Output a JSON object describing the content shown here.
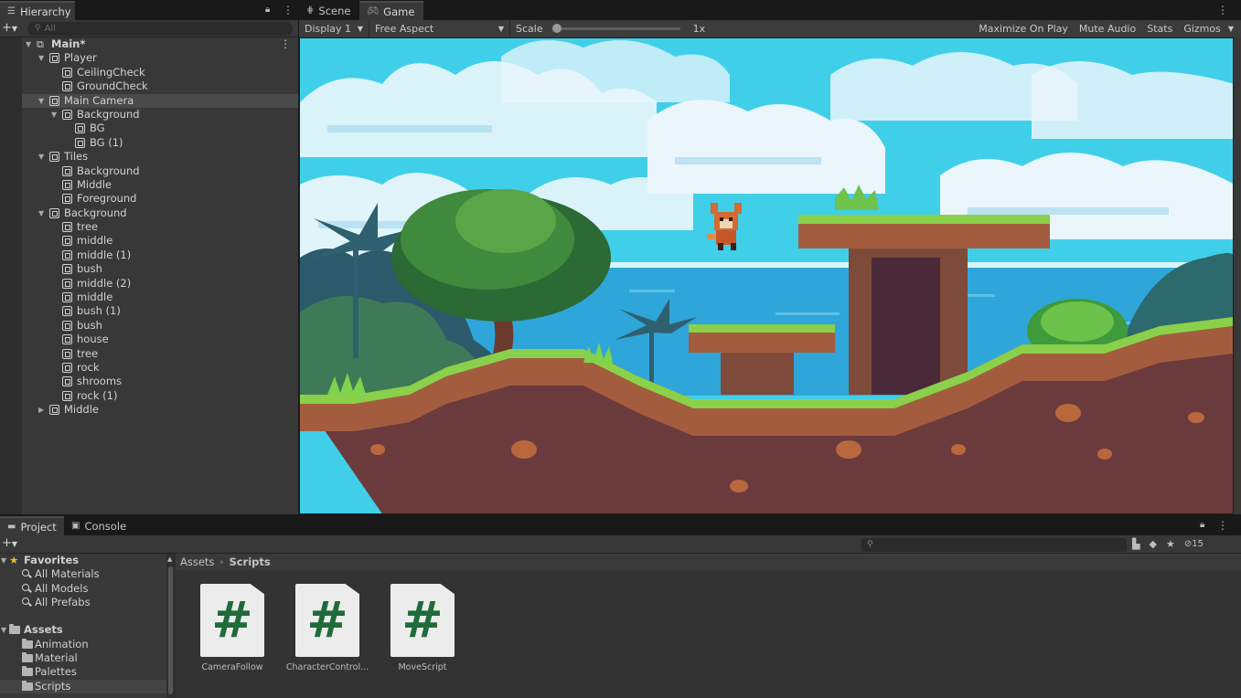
{
  "hierarchy": {
    "tab_label": "Hierarchy",
    "search_placeholder": "All",
    "items": [
      {
        "label": "Main*",
        "depth": 0,
        "arrow": "down",
        "kind": "scene"
      },
      {
        "label": "Player",
        "depth": 1,
        "arrow": "down",
        "kind": "object"
      },
      {
        "label": "CeilingCheck",
        "depth": 2,
        "arrow": "",
        "kind": "object"
      },
      {
        "label": "GroundCheck",
        "depth": 2,
        "arrow": "",
        "kind": "object"
      },
      {
        "label": "Main Camera",
        "depth": 1,
        "arrow": "down",
        "kind": "object",
        "selected": true
      },
      {
        "label": "Background",
        "depth": 2,
        "arrow": "down",
        "kind": "object"
      },
      {
        "label": "BG",
        "depth": 3,
        "arrow": "",
        "kind": "object"
      },
      {
        "label": "BG (1)",
        "depth": 3,
        "arrow": "",
        "kind": "object"
      },
      {
        "label": "Tiles",
        "depth": 1,
        "arrow": "down",
        "kind": "object"
      },
      {
        "label": "Background",
        "depth": 2,
        "arrow": "",
        "kind": "object"
      },
      {
        "label": "Middle",
        "depth": 2,
        "arrow": "",
        "kind": "object"
      },
      {
        "label": "Foreground",
        "depth": 2,
        "arrow": "",
        "kind": "object"
      },
      {
        "label": "Background",
        "depth": 1,
        "arrow": "down",
        "kind": "object"
      },
      {
        "label": "tree",
        "depth": 2,
        "arrow": "",
        "kind": "object"
      },
      {
        "label": "middle",
        "depth": 2,
        "arrow": "",
        "kind": "object"
      },
      {
        "label": "middle (1)",
        "depth": 2,
        "arrow": "",
        "kind": "object"
      },
      {
        "label": "bush",
        "depth": 2,
        "arrow": "",
        "kind": "object"
      },
      {
        "label": "middle (2)",
        "depth": 2,
        "arrow": "",
        "kind": "object"
      },
      {
        "label": "middle",
        "depth": 2,
        "arrow": "",
        "kind": "object"
      },
      {
        "label": "bush (1)",
        "depth": 2,
        "arrow": "",
        "kind": "object"
      },
      {
        "label": "bush",
        "depth": 2,
        "arrow": "",
        "kind": "object"
      },
      {
        "label": "house",
        "depth": 2,
        "arrow": "",
        "kind": "object"
      },
      {
        "label": "tree",
        "depth": 2,
        "arrow": "",
        "kind": "object"
      },
      {
        "label": "rock",
        "depth": 2,
        "arrow": "",
        "kind": "object"
      },
      {
        "label": "shrooms",
        "depth": 2,
        "arrow": "",
        "kind": "object"
      },
      {
        "label": "rock (1)",
        "depth": 2,
        "arrow": "",
        "kind": "object"
      },
      {
        "label": "Middle",
        "depth": 1,
        "arrow": "right",
        "kind": "object"
      }
    ]
  },
  "game": {
    "tabs": [
      {
        "label": "Scene",
        "icon": "hash-grid-icon"
      },
      {
        "label": "Game",
        "icon": "gamepad-icon"
      }
    ],
    "display": "Display 1",
    "aspect": "Free Aspect",
    "scale_label": "Scale",
    "scale_value": "1x",
    "scale_fraction": 0.0,
    "maximize_on_play": "Maximize On Play",
    "mute_audio": "Mute Audio",
    "stats": "Stats",
    "gizmos": "Gizmos"
  },
  "project": {
    "tabs": [
      {
        "label": "Project",
        "icon": "folder-icon"
      },
      {
        "label": "Console",
        "icon": "console-icon"
      }
    ],
    "hidden_count": "15",
    "favorites_label": "Favorites",
    "favorites": [
      "All Materials",
      "All Models",
      "All Prefabs"
    ],
    "assets_label": "Assets",
    "folders": [
      "Animation",
      "Material",
      "Palettes",
      "Scripts"
    ],
    "selected_folder": "Scripts",
    "breadcrumb": [
      "Assets",
      "Scripts"
    ],
    "files": [
      {
        "name": "CameraFollow",
        "glyph": "#"
      },
      {
        "name": "CharacterControl...",
        "glyph": "#"
      },
      {
        "name": "MoveScript",
        "glyph": "#"
      }
    ]
  },
  "colors": {
    "panel": "#383838",
    "sky": "#3fd0e8",
    "sea": "#2fa8d8",
    "grass": "#8ad04a",
    "dirt": "#6a3a3c",
    "script_hash": "#1f6b3a"
  }
}
